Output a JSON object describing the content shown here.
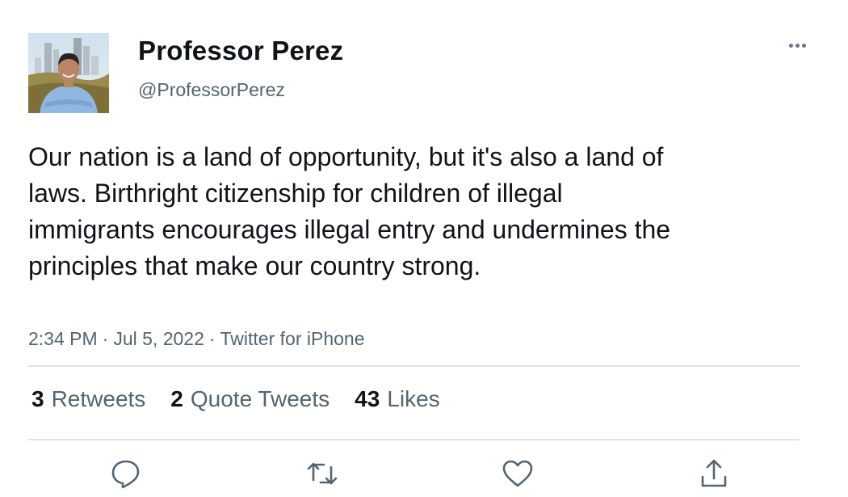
{
  "tweet": {
    "author": {
      "display_name": "Professor Perez",
      "handle": "@ProfessorPerez"
    },
    "text": "Our nation is a land of opportunity, but it's also a land of laws. Birthright citizenship for children of illegal immigrants encourages illegal entry and undermines the principles that make our country strong.",
    "time": "2:34 PM",
    "separator": "·",
    "date": "Jul 5, 2022",
    "source": "Twitter for iPhone",
    "stats": {
      "retweets_count": "3",
      "retweets_label": "Retweets",
      "quotes_count": "2",
      "quotes_label": "Quote Tweets",
      "likes_count": "43",
      "likes_label": "Likes"
    },
    "actions": [
      "reply-icon",
      "retweet-icon",
      "like-icon",
      "share-icon"
    ]
  },
  "colors": {
    "text_primary": "#0f1419",
    "text_secondary": "#536471",
    "icon": "#536471",
    "divider": "#dfe3e6"
  }
}
